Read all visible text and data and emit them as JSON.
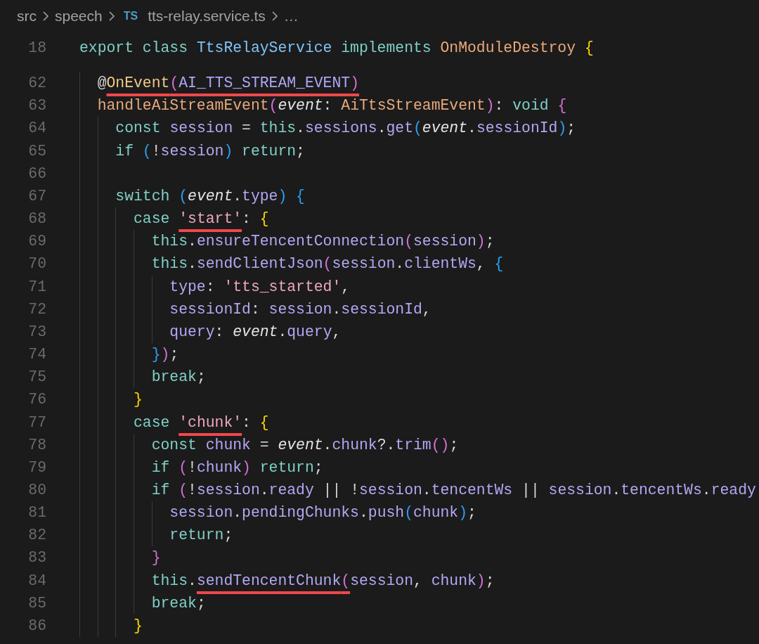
{
  "breadcrumb": {
    "items": [
      {
        "text": "src"
      },
      {
        "text": "speech"
      },
      {
        "text": "tts-relay.service.ts",
        "badge": "TS"
      },
      {
        "text": "…"
      }
    ]
  },
  "sticky_line": {
    "number": "18",
    "tokens": [
      {
        "kind": "keyword",
        "text": "export class "
      },
      {
        "kind": "class",
        "text": "TtsRelayService"
      },
      {
        "kind": "keyword",
        "text": " implements "
      },
      {
        "kind": "type",
        "text": "OnModuleDestroy "
      },
      {
        "kind": "bracket1",
        "text": "{"
      }
    ]
  },
  "lines": [
    {
      "number": "62",
      "tokens": [
        {
          "kind": "plain",
          "text": "  @"
        },
        {
          "kind": "underlined",
          "tokens": [
            {
              "kind": "decorator",
              "text": "OnEvent"
            },
            {
              "kind": "bracket2",
              "text": "("
            },
            {
              "kind": "constant",
              "text": "AI_TTS_STREAM_EVENT"
            },
            {
              "kind": "bracket2",
              "text": ")"
            }
          ]
        }
      ]
    },
    {
      "number": "63",
      "tokens": [
        {
          "kind": "type",
          "text": "  handleAiStreamEvent"
        },
        {
          "kind": "bracket2",
          "text": "("
        },
        {
          "kind": "param",
          "text": "event"
        },
        {
          "kind": "plain",
          "text": ": "
        },
        {
          "kind": "type",
          "text": "AiTtsStreamEvent"
        },
        {
          "kind": "bracket2",
          "text": ")"
        },
        {
          "kind": "plain",
          "text": ": "
        },
        {
          "kind": "keyword",
          "text": "void "
        },
        {
          "kind": "bracket2",
          "text": "{"
        }
      ]
    },
    {
      "number": "64",
      "tokens": [
        {
          "kind": "keyword",
          "text": "    const "
        },
        {
          "kind": "variable",
          "text": "session"
        },
        {
          "kind": "plain",
          "text": " = "
        },
        {
          "kind": "keyword",
          "text": "this"
        },
        {
          "kind": "plain",
          "text": "."
        },
        {
          "kind": "variable",
          "text": "sessions"
        },
        {
          "kind": "plain",
          "text": "."
        },
        {
          "kind": "variable",
          "text": "get"
        },
        {
          "kind": "bracket3",
          "text": "("
        },
        {
          "kind": "param",
          "text": "event"
        },
        {
          "kind": "plain",
          "text": "."
        },
        {
          "kind": "variable",
          "text": "sessionId"
        },
        {
          "kind": "bracket3",
          "text": ")"
        },
        {
          "kind": "plain",
          "text": ";"
        }
      ]
    },
    {
      "number": "65",
      "tokens": [
        {
          "kind": "keyword",
          "text": "    if "
        },
        {
          "kind": "bracket3",
          "text": "("
        },
        {
          "kind": "plain",
          "text": "!"
        },
        {
          "kind": "variable",
          "text": "session"
        },
        {
          "kind": "bracket3",
          "text": ")"
        },
        {
          "kind": "keyword",
          "text": " return"
        },
        {
          "kind": "plain",
          "text": ";"
        }
      ]
    },
    {
      "number": "66"
    },
    {
      "number": "67",
      "tokens": [
        {
          "kind": "keyword",
          "text": "    switch "
        },
        {
          "kind": "bracket3",
          "text": "("
        },
        {
          "kind": "param",
          "text": "event"
        },
        {
          "kind": "plain",
          "text": "."
        },
        {
          "kind": "variable",
          "text": "type"
        },
        {
          "kind": "bracket3",
          "text": ") {"
        }
      ]
    },
    {
      "number": "68",
      "tokens": [
        {
          "kind": "keyword",
          "text": "      case "
        },
        {
          "kind": "underlined",
          "tokens": [
            {
              "kind": "string",
              "text": "'start'"
            }
          ]
        },
        {
          "kind": "plain",
          "text": ": "
        },
        {
          "kind": "bracket1",
          "text": "{"
        }
      ]
    },
    {
      "number": "69",
      "tokens": [
        {
          "kind": "keyword",
          "text": "        this"
        },
        {
          "kind": "plain",
          "text": "."
        },
        {
          "kind": "variable",
          "text": "ensureTencentConnection"
        },
        {
          "kind": "bracket2",
          "text": "("
        },
        {
          "kind": "variable",
          "text": "session"
        },
        {
          "kind": "bracket2",
          "text": ")"
        },
        {
          "kind": "plain",
          "text": ";"
        }
      ]
    },
    {
      "number": "70",
      "tokens": [
        {
          "kind": "keyword",
          "text": "        this"
        },
        {
          "kind": "plain",
          "text": "."
        },
        {
          "kind": "variable",
          "text": "sendClientJson"
        },
        {
          "kind": "bracket2",
          "text": "("
        },
        {
          "kind": "variable",
          "text": "session"
        },
        {
          "kind": "plain",
          "text": "."
        },
        {
          "kind": "variable",
          "text": "clientWs"
        },
        {
          "kind": "plain",
          "text": ", "
        },
        {
          "kind": "bracket3",
          "text": "{"
        }
      ]
    },
    {
      "number": "71",
      "tokens": [
        {
          "kind": "variable",
          "text": "          type"
        },
        {
          "kind": "plain",
          "text": ": "
        },
        {
          "kind": "string",
          "text": "'tts_started'"
        },
        {
          "kind": "plain",
          "text": ","
        }
      ]
    },
    {
      "number": "72",
      "tokens": [
        {
          "kind": "variable",
          "text": "          sessionId"
        },
        {
          "kind": "plain",
          "text": ": "
        },
        {
          "kind": "variable",
          "text": "session"
        },
        {
          "kind": "plain",
          "text": "."
        },
        {
          "kind": "variable",
          "text": "sessionId"
        },
        {
          "kind": "plain",
          "text": ","
        }
      ]
    },
    {
      "number": "73",
      "tokens": [
        {
          "kind": "variable",
          "text": "          query"
        },
        {
          "kind": "plain",
          "text": ": "
        },
        {
          "kind": "param",
          "text": "event"
        },
        {
          "kind": "plain",
          "text": "."
        },
        {
          "kind": "variable",
          "text": "query"
        },
        {
          "kind": "plain",
          "text": ","
        }
      ]
    },
    {
      "number": "74",
      "tokens": [
        {
          "kind": "bracket3",
          "text": "        }"
        },
        {
          "kind": "bracket2",
          "text": ")"
        },
        {
          "kind": "plain",
          "text": ";"
        }
      ]
    },
    {
      "number": "75",
      "tokens": [
        {
          "kind": "keyword",
          "text": "        break"
        },
        {
          "kind": "plain",
          "text": ";"
        }
      ]
    },
    {
      "number": "76",
      "tokens": [
        {
          "kind": "bracket1",
          "text": "      }"
        }
      ]
    },
    {
      "number": "77",
      "tokens": [
        {
          "kind": "keyword",
          "text": "      case "
        },
        {
          "kind": "underlined",
          "tokens": [
            {
              "kind": "string",
              "text": "'chunk'"
            }
          ]
        },
        {
          "kind": "plain",
          "text": ": "
        },
        {
          "kind": "bracket1",
          "text": "{"
        }
      ]
    },
    {
      "number": "78",
      "tokens": [
        {
          "kind": "keyword",
          "text": "        const "
        },
        {
          "kind": "variable",
          "text": "chunk"
        },
        {
          "kind": "plain",
          "text": " = "
        },
        {
          "kind": "param",
          "text": "event"
        },
        {
          "kind": "plain",
          "text": "."
        },
        {
          "kind": "variable",
          "text": "chunk"
        },
        {
          "kind": "plain",
          "text": "?."
        },
        {
          "kind": "variable",
          "text": "trim"
        },
        {
          "kind": "bracket2",
          "text": "()"
        },
        {
          "kind": "plain",
          "text": ";"
        }
      ]
    },
    {
      "number": "79",
      "tokens": [
        {
          "kind": "keyword",
          "text": "        if "
        },
        {
          "kind": "bracket2",
          "text": "("
        },
        {
          "kind": "plain",
          "text": "!"
        },
        {
          "kind": "variable",
          "text": "chunk"
        },
        {
          "kind": "bracket2",
          "text": ")"
        },
        {
          "kind": "keyword",
          "text": " return"
        },
        {
          "kind": "plain",
          "text": ";"
        }
      ]
    },
    {
      "number": "80",
      "tokens": [
        {
          "kind": "keyword",
          "text": "        if "
        },
        {
          "kind": "bracket2",
          "text": "("
        },
        {
          "kind": "plain",
          "text": "!"
        },
        {
          "kind": "variable",
          "text": "session"
        },
        {
          "kind": "plain",
          "text": "."
        },
        {
          "kind": "variable",
          "text": "ready"
        },
        {
          "kind": "plain",
          "text": " || !"
        },
        {
          "kind": "variable",
          "text": "session"
        },
        {
          "kind": "plain",
          "text": "."
        },
        {
          "kind": "variable",
          "text": "tencentWs"
        },
        {
          "kind": "plain",
          "text": " || "
        },
        {
          "kind": "variable",
          "text": "session"
        },
        {
          "kind": "plain",
          "text": "."
        },
        {
          "kind": "variable",
          "text": "tencentWs"
        },
        {
          "kind": "plain",
          "text": "."
        },
        {
          "kind": "variable",
          "text": "ready"
        }
      ]
    },
    {
      "number": "81",
      "tokens": [
        {
          "kind": "variable",
          "text": "          session"
        },
        {
          "kind": "plain",
          "text": "."
        },
        {
          "kind": "variable",
          "text": "pendingChunks"
        },
        {
          "kind": "plain",
          "text": "."
        },
        {
          "kind": "variable",
          "text": "push"
        },
        {
          "kind": "bracket3",
          "text": "("
        },
        {
          "kind": "variable",
          "text": "chunk"
        },
        {
          "kind": "bracket3",
          "text": ")"
        },
        {
          "kind": "plain",
          "text": ";"
        }
      ]
    },
    {
      "number": "82",
      "tokens": [
        {
          "kind": "keyword",
          "text": "          return"
        },
        {
          "kind": "plain",
          "text": ";"
        }
      ]
    },
    {
      "number": "83",
      "tokens": [
        {
          "kind": "bracket2",
          "text": "        }"
        }
      ]
    },
    {
      "number": "84",
      "tokens": [
        {
          "kind": "keyword",
          "text": "        this"
        },
        {
          "kind": "plain",
          "text": "."
        },
        {
          "kind": "underlined",
          "tokens": [
            {
              "kind": "variable",
              "text": "sendTencentChunk"
            },
            {
              "kind": "bracket2",
              "text": "("
            }
          ]
        },
        {
          "kind": "variable",
          "text": "session"
        },
        {
          "kind": "plain",
          "text": ", "
        },
        {
          "kind": "variable",
          "text": "chunk"
        },
        {
          "kind": "bracket2",
          "text": ")"
        },
        {
          "kind": "plain",
          "text": ";"
        }
      ]
    },
    {
      "number": "85",
      "tokens": [
        {
          "kind": "keyword",
          "text": "        break"
        },
        {
          "kind": "plain",
          "text": ";"
        }
      ]
    },
    {
      "number": "86",
      "tokens": [
        {
          "kind": "bracket1",
          "text": "      }"
        }
      ]
    }
  ]
}
